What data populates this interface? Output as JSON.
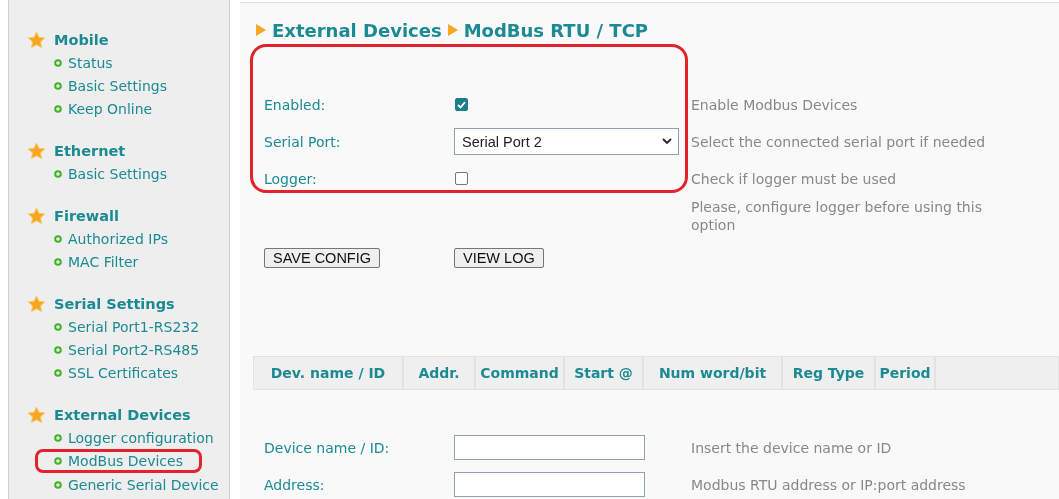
{
  "sidebar": {
    "groups": [
      {
        "title": "Mobile",
        "items": [
          {
            "label": "Status",
            "highlighted": false
          },
          {
            "label": "Basic Settings",
            "highlighted": false
          },
          {
            "label": "Keep Online",
            "highlighted": false
          }
        ]
      },
      {
        "title": "Ethernet",
        "items": [
          {
            "label": "Basic Settings",
            "highlighted": false
          }
        ]
      },
      {
        "title": "Firewall",
        "items": [
          {
            "label": "Authorized IPs",
            "highlighted": false
          },
          {
            "label": "MAC Filter",
            "highlighted": false
          }
        ]
      },
      {
        "title": "Serial Settings",
        "items": [
          {
            "label": "Serial Port1-RS232",
            "highlighted": false
          },
          {
            "label": "Serial Port2-RS485",
            "highlighted": false
          },
          {
            "label": "SSL Certificates",
            "highlighted": false
          }
        ]
      },
      {
        "title": "External Devices",
        "items": [
          {
            "label": "Logger configuration",
            "highlighted": false
          },
          {
            "label": "ModBus Devices",
            "highlighted": true
          },
          {
            "label": "Generic Serial Device",
            "highlighted": false
          }
        ]
      }
    ]
  },
  "breadcrumb": [
    "External Devices",
    "ModBus RTU / TCP"
  ],
  "settings": {
    "highlighted": true,
    "rows": [
      {
        "kind": "checkbox",
        "label": "Enabled:",
        "checked": true,
        "help": "Enable Modbus Devices"
      },
      {
        "kind": "select",
        "label": "Serial Port:",
        "value": "Serial Port 2",
        "help": "Select the connected serial port if needed"
      },
      {
        "kind": "checkbox",
        "label": "Logger:",
        "checked": false,
        "help": "Check if logger must be used"
      }
    ],
    "note": "Please, configure logger before using this option"
  },
  "buttons": [
    "SAVE CONFIG",
    "VIEW LOG"
  ],
  "table": {
    "columns": [
      "Dev. name / ID",
      "Addr.",
      "Command",
      "Start @",
      "Num word/bit",
      "Reg Type",
      "Period"
    ]
  },
  "device_form": [
    {
      "label": "Device name / ID:",
      "help": "Insert the device name or ID"
    },
    {
      "label": "Address:",
      "help": "Modbus RTU address or IP:port address"
    }
  ]
}
